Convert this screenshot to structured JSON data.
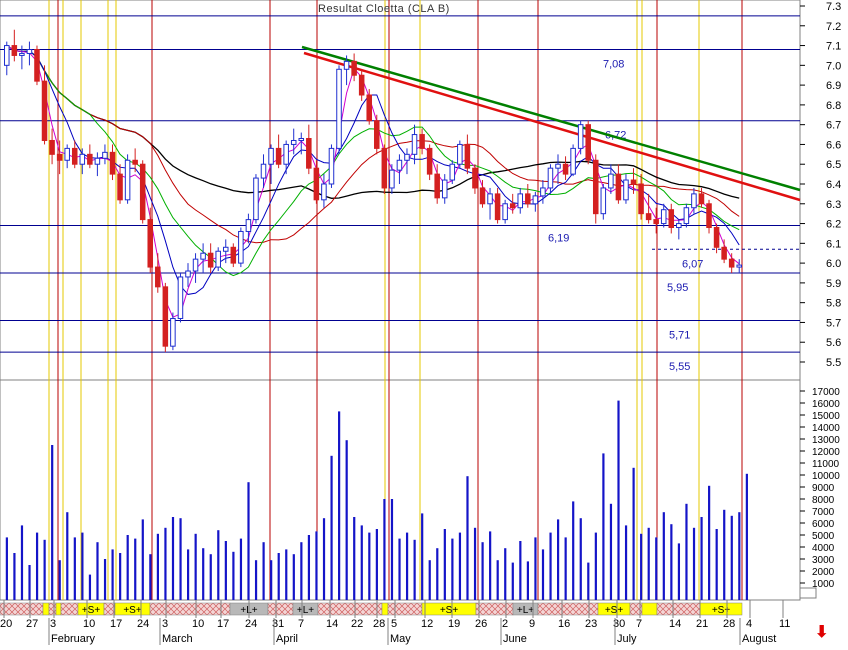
{
  "title": "Resultat Cloetta (CLA B)",
  "colors": {
    "up_candle": "#1f2fd0",
    "down_candle": "#d42020",
    "volume": "#1414c8",
    "red_vline": "#b80000",
    "yellow_vline": "#e6c800",
    "support_line": "#000090",
    "trend_red": "#e01010",
    "trend_green": "#008000",
    "ma_black": "#000000",
    "ma_red": "#c00000",
    "ma_green": "#00b000",
    "ma_blue": "#0000c0",
    "ma_magenta": "#d000d0",
    "signal_buy": "#ffff00",
    "signal_neutral": "#b8b8b8",
    "level_label": "#1a1ab0"
  },
  "chart_data": {
    "type": "candlestick",
    "title": "Resultat Cloetta (CLA B)",
    "price_axis": {
      "min": 5.5,
      "max": 7.3,
      "ticks": [
        "7.3",
        "7.2",
        "7.1",
        "7.0",
        "6.9",
        "6.8",
        "6.7",
        "6.6",
        "6.5",
        "6.4",
        "6.3",
        "6.2",
        "6.1",
        "6.0",
        "5.9",
        "5.8",
        "5.7",
        "5.6",
        "5.5"
      ]
    },
    "volume_axis": {
      "min": 0,
      "max": 17000,
      "ticks": [
        "17000",
        "16000",
        "15000",
        "14000",
        "13000",
        "12000",
        "11000",
        "10000",
        "9000",
        "8000",
        "7000",
        "6000",
        "5000",
        "4000",
        "3000",
        "2000",
        "1000"
      ]
    },
    "level_lines": [
      {
        "value": 7.08,
        "label": "7,08"
      },
      {
        "value": 6.72,
        "label": "6,72"
      },
      {
        "value": 6.19,
        "label": "6,19"
      },
      {
        "value": 6.07,
        "label": "6,07",
        "dashed": true
      },
      {
        "value": 5.95,
        "label": "5,95"
      },
      {
        "value": 5.71,
        "label": "5,71"
      },
      {
        "value": 5.55,
        "label": "5,55"
      }
    ],
    "x_tick_labels": [
      "20",
      "27",
      "3",
      "10",
      "17",
      "24",
      "3",
      "10",
      "17",
      "24",
      "31",
      "7",
      "14",
      "22",
      "28",
      "5",
      "12",
      "19",
      "26",
      "2",
      "9",
      "16",
      "23",
      "30",
      "7",
      "14",
      "21",
      "28",
      "4",
      "11"
    ],
    "month_labels": [
      "February",
      "March",
      "April",
      "May",
      "June",
      "July",
      "August"
    ],
    "signal_labels": [
      "+S+",
      "+S+",
      "+L+",
      "+L+",
      "+S+",
      "+L+",
      "+S+",
      "+S+"
    ],
    "candles": [
      [
        7.0,
        7.12,
        6.95,
        7.1
      ],
      [
        7.1,
        7.18,
        7.02,
        7.05
      ],
      [
        7.05,
        7.1,
        6.98,
        7.06
      ],
      [
        7.06,
        7.12,
        7.0,
        7.08
      ],
      [
        7.08,
        7.1,
        6.9,
        6.92
      ],
      [
        6.92,
        7.0,
        6.6,
        6.62
      ],
      [
        6.62,
        6.68,
        6.5,
        6.55
      ],
      [
        6.55,
        6.62,
        6.45,
        6.52
      ],
      [
        6.52,
        6.6,
        6.48,
        6.58
      ],
      [
        6.58,
        6.62,
        6.48,
        6.5
      ],
      [
        6.5,
        6.58,
        6.45,
        6.55
      ],
      [
        6.55,
        6.6,
        6.48,
        6.5
      ],
      [
        6.5,
        6.56,
        6.44,
        6.53
      ],
      [
        6.53,
        6.6,
        6.5,
        6.56
      ],
      [
        6.56,
        6.6,
        6.42,
        6.45
      ],
      [
        6.45,
        6.5,
        6.3,
        6.32
      ],
      [
        6.32,
        6.55,
        6.3,
        6.52
      ],
      [
        6.52,
        6.58,
        6.46,
        6.5
      ],
      [
        6.5,
        6.52,
        6.2,
        6.22
      ],
      [
        6.22,
        6.28,
        5.95,
        5.98
      ],
      [
        5.98,
        6.05,
        5.85,
        5.88
      ],
      [
        5.88,
        5.9,
        5.55,
        5.58
      ],
      [
        5.58,
        5.75,
        5.56,
        5.72
      ],
      [
        5.72,
        5.95,
        5.7,
        5.93
      ],
      [
        5.93,
        6.0,
        5.88,
        5.96
      ],
      [
        5.96,
        6.05,
        5.9,
        6.02
      ],
      [
        6.02,
        6.1,
        5.95,
        6.05
      ],
      [
        6.05,
        6.1,
        5.95,
        5.98
      ],
      [
        5.98,
        6.08,
        5.96,
        6.06
      ],
      [
        6.06,
        6.12,
        6.0,
        6.08
      ],
      [
        6.08,
        6.1,
        5.98,
        6.0
      ],
      [
        6.0,
        6.18,
        5.98,
        6.16
      ],
      [
        6.16,
        6.25,
        6.1,
        6.22
      ],
      [
        6.22,
        6.45,
        6.2,
        6.43
      ],
      [
        6.43,
        6.55,
        6.38,
        6.5
      ],
      [
        6.5,
        6.6,
        6.4,
        6.58
      ],
      [
        6.58,
        6.65,
        6.48,
        6.5
      ],
      [
        6.5,
        6.62,
        6.45,
        6.6
      ],
      [
        6.6,
        6.68,
        6.55,
        6.62
      ],
      [
        6.62,
        6.66,
        6.55,
        6.63
      ],
      [
        6.63,
        6.7,
        6.45,
        6.48
      ],
      [
        6.48,
        6.52,
        6.3,
        6.32
      ],
      [
        6.32,
        6.45,
        6.28,
        6.4
      ],
      [
        6.4,
        6.6,
        6.38,
        6.58
      ],
      [
        6.58,
        7.0,
        6.55,
        6.98
      ],
      [
        6.98,
        7.05,
        6.9,
        7.02
      ],
      [
        7.02,
        7.06,
        6.92,
        6.95
      ],
      [
        6.95,
        6.98,
        6.82,
        6.85
      ],
      [
        6.85,
        6.88,
        6.7,
        6.72
      ],
      [
        6.72,
        6.75,
        6.55,
        6.58
      ],
      [
        6.58,
        6.6,
        6.35,
        6.38
      ],
      [
        6.38,
        6.5,
        6.35,
        6.47
      ],
      [
        6.47,
        6.55,
        6.4,
        6.52
      ],
      [
        6.52,
        6.58,
        6.45,
        6.55
      ],
      [
        6.55,
        6.7,
        6.5,
        6.65
      ],
      [
        6.65,
        6.68,
        6.55,
        6.58
      ],
      [
        6.58,
        6.6,
        6.42,
        6.45
      ],
      [
        6.45,
        6.5,
        6.3,
        6.33
      ],
      [
        6.33,
        6.45,
        6.3,
        6.42
      ],
      [
        6.42,
        6.52,
        6.4,
        6.5
      ],
      [
        6.5,
        6.62,
        6.48,
        6.6
      ],
      [
        6.6,
        6.65,
        6.45,
        6.48
      ],
      [
        6.48,
        6.5,
        6.35,
        6.38
      ],
      [
        6.38,
        6.42,
        6.28,
        6.3
      ],
      [
        6.3,
        6.38,
        6.22,
        6.35
      ],
      [
        6.35,
        6.38,
        6.2,
        6.22
      ],
      [
        6.22,
        6.32,
        6.2,
        6.3
      ],
      [
        6.3,
        6.35,
        6.25,
        6.28
      ],
      [
        6.28,
        6.38,
        6.25,
        6.35
      ],
      [
        6.35,
        6.4,
        6.28,
        6.3
      ],
      [
        6.3,
        6.36,
        6.26,
        6.34
      ],
      [
        6.34,
        6.42,
        6.3,
        6.38
      ],
      [
        6.38,
        6.5,
        6.35,
        6.48
      ],
      [
        6.48,
        6.55,
        6.4,
        6.5
      ],
      [
        6.5,
        6.54,
        6.42,
        6.45
      ],
      [
        6.45,
        6.6,
        6.44,
        6.58
      ],
      [
        6.58,
        6.72,
        6.55,
        6.7
      ],
      [
        6.7,
        6.72,
        6.5,
        6.52
      ],
      [
        6.52,
        6.55,
        6.2,
        6.25
      ],
      [
        6.25,
        6.4,
        6.22,
        6.38
      ],
      [
        6.38,
        6.5,
        6.35,
        6.45
      ],
      [
        6.45,
        6.5,
        6.3,
        6.32
      ],
      [
        6.32,
        6.45,
        6.3,
        6.42
      ],
      [
        6.42,
        6.48,
        6.35,
        6.4
      ],
      [
        6.4,
        6.45,
        6.22,
        6.25
      ],
      [
        6.25,
        6.35,
        6.2,
        6.22
      ],
      [
        6.22,
        6.28,
        6.15,
        6.2
      ],
      [
        6.2,
        6.3,
        6.18,
        6.27
      ],
      [
        6.27,
        6.3,
        6.15,
        6.18
      ],
      [
        6.18,
        6.22,
        6.12,
        6.2
      ],
      [
        6.2,
        6.3,
        6.18,
        6.28
      ],
      [
        6.28,
        6.38,
        6.25,
        6.35
      ],
      [
        6.35,
        6.38,
        6.28,
        6.3
      ],
      [
        6.3,
        6.32,
        6.15,
        6.18
      ],
      [
        6.18,
        6.2,
        6.05,
        6.08
      ],
      [
        6.08,
        6.12,
        6.0,
        6.02
      ],
      [
        6.02,
        6.05,
        5.95,
        5.98
      ],
      [
        5.98,
        6.02,
        5.95,
        5.99
      ]
    ],
    "volume": [
      4800,
      3500,
      5800,
      2500,
      5200,
      4600,
      12500,
      2900,
      6900,
      4800,
      5200,
      1700,
      4400,
      3000,
      3800,
      3500,
      5000,
      4700,
      6300,
      3400,
      5100,
      5600,
      6500,
      6400,
      3800,
      5100,
      3900,
      3400,
      5400,
      4500,
      3600,
      4700,
      9400,
      2900,
      4400,
      2900,
      3500,
      3800,
      3400,
      4400,
      5000,
      5300,
      6400,
      11600,
      15300,
      12900,
      6500,
      5800,
      5200,
      5500,
      8000,
      8000,
      4700,
      5200,
      4600,
      6800,
      2900,
      3900,
      5500,
      4700,
      5200,
      9900,
      5600,
      4400,
      5300,
      2900,
      3900,
      2700,
      4500,
      2800,
      4800,
      3800,
      5200,
      6300,
      4800,
      7800,
      6400,
      2700,
      5200,
      11800,
      7600,
      16200,
      5800,
      10600,
      5100,
      5600,
      4800,
      6900,
      5900,
      4300,
      7600,
      5600,
      6500,
      9100,
      5500,
      7100,
      6600,
      6900,
      10100
    ]
  }
}
